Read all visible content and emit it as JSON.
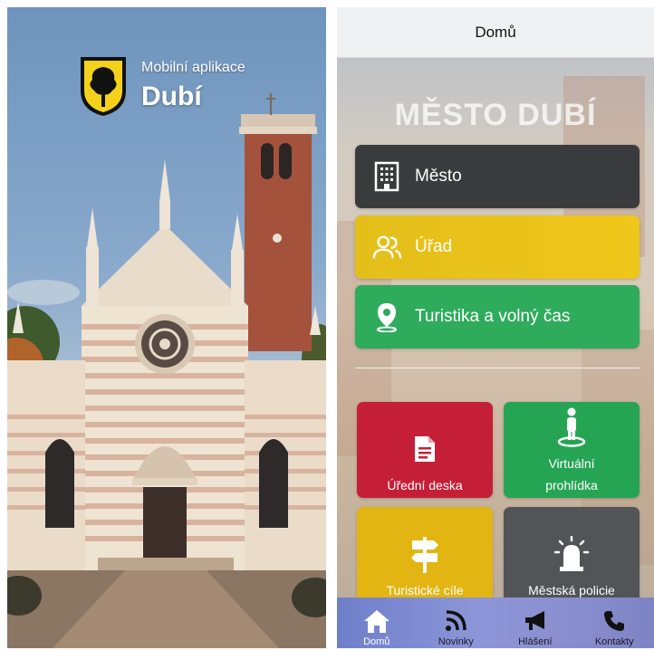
{
  "splash": {
    "subtitle": "Mobilní aplikace",
    "title": "Dubí",
    "crest_icon": "town-crest-tree-icon",
    "background": "church-photo"
  },
  "home": {
    "header_title": "Domů",
    "city_title": "MĚSTO DUBÍ",
    "wide_buttons": [
      {
        "label": "Město",
        "icon": "building-icon",
        "color": "#3a3b3d"
      },
      {
        "label": "Úřad",
        "icon": "people-icon",
        "color": "#e4bf1a"
      },
      {
        "label": "Turistika a volný čas",
        "icon": "location-pin-icon",
        "color": "#2eab5b"
      }
    ],
    "tiles": [
      {
        "label": "Úřední deska",
        "icon": "document-icon",
        "color": "#c51f38"
      },
      {
        "label": "Virtuální prohlídka",
        "icon": "person-on-spot-icon",
        "color": "#25a554"
      },
      {
        "label": "Turistické cíle",
        "icon": "signpost-icon",
        "color": "#e2b513"
      },
      {
        "label": "Městská policie",
        "icon": "siren-icon",
        "color": "#525457"
      }
    ],
    "nav": [
      {
        "label": "Domů",
        "icon": "home-icon",
        "active": true
      },
      {
        "label": "Novinky",
        "icon": "rss-icon",
        "active": false
      },
      {
        "label": "Hlášení",
        "icon": "megaphone-icon",
        "active": false
      },
      {
        "label": "Kontakty",
        "icon": "phone-icon",
        "active": false
      }
    ]
  }
}
